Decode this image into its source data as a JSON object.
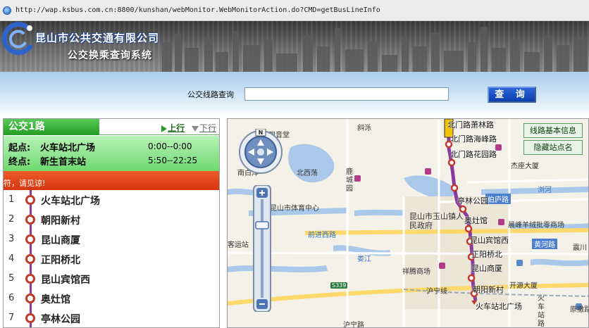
{
  "address_bar": {
    "url": "http://wap.ksbus.com.cn:8800/kunshan/webMonitor.WebMonitorAction.do?CMD=getBusLineInfo"
  },
  "header": {
    "company_name": "昆山市公共交通有限公司",
    "system_name": "公交换乘查询系统"
  },
  "search": {
    "label": "公交线路查询",
    "value": "",
    "button_label": "查 询"
  },
  "route": {
    "tab_label": "公交1路",
    "prev_label": "上行",
    "next_label": "下行",
    "start_label": "起点:",
    "start_stop": "火车站北广场",
    "start_time": "0:00--0:00",
    "end_label": "终点:",
    "end_stop": "新生首末站",
    "end_time": "5:50--22:25",
    "notice": "符，请见谅!"
  },
  "stops": [
    {
      "num": "1",
      "name": "火车站北广场"
    },
    {
      "num": "2",
      "name": "朝阳新村"
    },
    {
      "num": "3",
      "name": "昆山商厦"
    },
    {
      "num": "4",
      "name": "正阳桥北"
    },
    {
      "num": "5",
      "name": "昆山宾馆西"
    },
    {
      "num": "6",
      "name": "奥灶馆"
    },
    {
      "num": "7",
      "name": "亭林公园"
    }
  ],
  "map": {
    "buttons": {
      "basic_info": "线路基本信息",
      "hide_stops": "隐藏站点名"
    },
    "compass_label": "N",
    "labels": {
      "l1": "斜泺",
      "l2": "观音堂",
      "l3": "南白洋",
      "l4": "北西荡",
      "l5": "鹿城园",
      "l6": "昆山市体育中心",
      "l7": "昆山市玉山镇人民政府",
      "l8": "前进西路",
      "l9": "客运站",
      "l10": "娄江",
      "l11": "祥腾商场",
      "l12": "沪宁线",
      "l13": "杰座大厦",
      "l14": "浏河",
      "l15": "晨峰羊绒批零商场",
      "l16": "黄河路",
      "l17": "震川",
      "l18": "开源大厦",
      "l19": "火车站路",
      "l20": "原撤路",
      "l21": "S339",
      "l22": "伯庐路",
      "l23": "沪宁路"
    },
    "stop_labels": {
      "s1": "北门路萧林路",
      "s2": "北门路海峰路",
      "s3": "北门路花园路",
      "s4": "亭林公园",
      "s5": "奥灶馆",
      "s6": "昆山宾馆西",
      "s7": "正阳桥北",
      "s8": "昆山商厦",
      "s9": "朝阳新村",
      "s10": "火车站北广场"
    },
    "route_color": "#8a3a9e"
  }
}
